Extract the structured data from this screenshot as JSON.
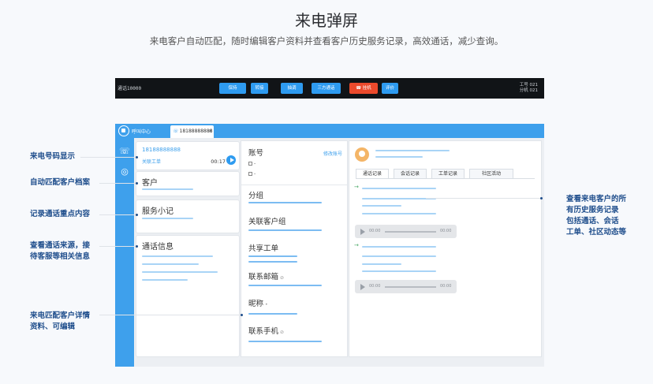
{
  "header": {
    "title": "来电弹屏",
    "subtitle": "来电客户自动匹配，随时编辑客户资料并查看客户历史服务记录，高效通话，减少查询。"
  },
  "toolbar": {
    "status": "通话10000",
    "buttons": [
      "保持",
      "转接",
      "抽调",
      "三方通话",
      "挂机",
      "评价"
    ],
    "hangup_icon": "phone-hangup-icon",
    "right_line1": "工号 021",
    "right_line2": "分机 021"
  },
  "app": {
    "name": "呼叫中心",
    "tab_label": "18188888888",
    "tab_close": "×",
    "sidebar_icons": [
      "phone-icon",
      "location-icon"
    ]
  },
  "call_card": {
    "number": "18188888888",
    "link": "关联工单",
    "duration": "00:17"
  },
  "col1_cards": {
    "customer": "客户",
    "notes": "服务小记",
    "call_info": "通话信息"
  },
  "col2": {
    "account": "账号",
    "edit_account": "修改账号",
    "option_dash": "-",
    "group": "分组",
    "related_group": "关联客户组",
    "shared_ticket": "共享工单",
    "email": "联系邮箱",
    "email_hint": "⊘",
    "nickname": "昵称",
    "nickname_mark": "•",
    "mobile": "联系手机",
    "mobile_hint": "⊘"
  },
  "col3": {
    "tabs": [
      "通话记录",
      "会话记录",
      "工单记录",
      "社区活动"
    ],
    "arrow": "→",
    "audio_start": "00:00",
    "audio_end": "00:00"
  },
  "annotations": {
    "left": [
      "来电号码显示",
      "自动匹配客户档案",
      "记录通话重点内容",
      "查看通话来源，接\n待客服等相关信息",
      "来电匹配客户详情\n资料、可编辑"
    ],
    "right": "查看来电客户的所\n有历史服务记录\n包括通话、会话\n工单、社区动态等"
  },
  "colors": {
    "accent": "#3ea0ec",
    "hangup": "#ec4a2c",
    "annotation": "#1f4e8c"
  }
}
